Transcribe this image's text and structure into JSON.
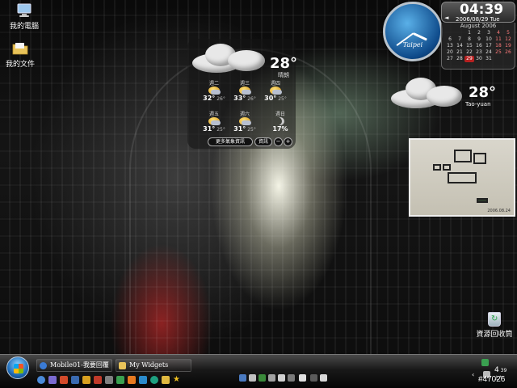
{
  "desktop": {
    "icons": [
      {
        "label": "我的電腦",
        "icon": "computer-icon"
      },
      {
        "label": "我的文件",
        "icon": "folder-icon"
      }
    ],
    "recycle_bin": {
      "label": "資源回收筒",
      "icon": "recycle-bin-icon"
    }
  },
  "weather_widget": {
    "current_temp": "28°",
    "current_condition": "晴朗",
    "forecast": [
      {
        "day": "週二",
        "high": "32°",
        "low": "26°"
      },
      {
        "day": "週三",
        "high": "33°",
        "low": "26°"
      },
      {
        "day": "週四",
        "high": "30°",
        "low": "25°"
      },
      {
        "day": "週五",
        "high": "31°",
        "low": "25°"
      },
      {
        "day": "週六",
        "high": "31°",
        "low": "25°"
      },
      {
        "day": "週日",
        "high": "",
        "low": ""
      }
    ],
    "precip": "17%",
    "more_button": "更多氣象資訊",
    "info_button": "資訊"
  },
  "clock_widget": {
    "city": "Taipei",
    "time_hour_fraction": 0.32,
    "time_minute_fraction": 0.65
  },
  "date_widget": {
    "time": "04:39",
    "date": "2006/08/29 Tue",
    "prev_arrow": "◄",
    "month": "August 2006",
    "days": [
      "",
      "",
      "1",
      "2",
      "3",
      "4",
      "5",
      "6",
      "7",
      "8",
      "9",
      "10",
      "11",
      "12",
      "13",
      "14",
      "15",
      "16",
      "17",
      "18",
      "19",
      "20",
      "21",
      "22",
      "23",
      "24",
      "25",
      "26",
      "27",
      "28",
      "29",
      "30",
      "31",
      "",
      ""
    ],
    "today": "29"
  },
  "weather_small": {
    "temp": "28°",
    "city": "Tao-yuan"
  },
  "photo_widget": {
    "stamp": "2006.08.24"
  },
  "taskbar": {
    "tasks": [
      {
        "label": "Mobile01-我要回覆 ..."
      },
      {
        "label": "My Widgets"
      }
    ],
    "clock_hour": "4",
    "clock_min": "39",
    "clock_ampm": "上午"
  },
  "watermark": "#47026",
  "colors": {
    "taskbar": "#141414",
    "clock_face": "#1e6bb8",
    "calendar_today": "#b72020",
    "text": "#ffffff"
  }
}
